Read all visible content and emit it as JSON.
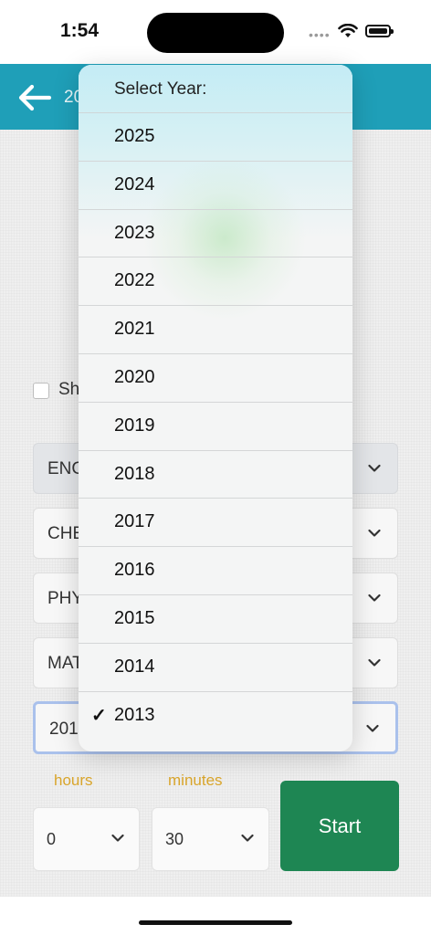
{
  "status_bar": {
    "time": "1:54"
  },
  "header": {
    "title": "20"
  },
  "content": {
    "show_checkbox_label": "Sh",
    "selects": [
      {
        "label": "ENC"
      },
      {
        "label": "CHE"
      },
      {
        "label": "PHY"
      },
      {
        "label": "MAT"
      },
      {
        "label": "2013"
      }
    ],
    "hours_label": "hours",
    "minutes_label": "minutes",
    "hours_value": "0",
    "minutes_value": "30",
    "start_label": "Start"
  },
  "dropdown": {
    "header": "Select Year:",
    "items": [
      "2025",
      "2024",
      "2023",
      "2022",
      "2021",
      "2020",
      "2019",
      "2018",
      "2017",
      "2016",
      "2015",
      "2014",
      "2013"
    ],
    "selected": "2013",
    "check_glyph": "✓"
  },
  "colors": {
    "header_bg": "#1f9fb8",
    "start_bg": "#1e8653",
    "label_accent": "#d9a52b",
    "focus_border": "#aac1ec"
  }
}
